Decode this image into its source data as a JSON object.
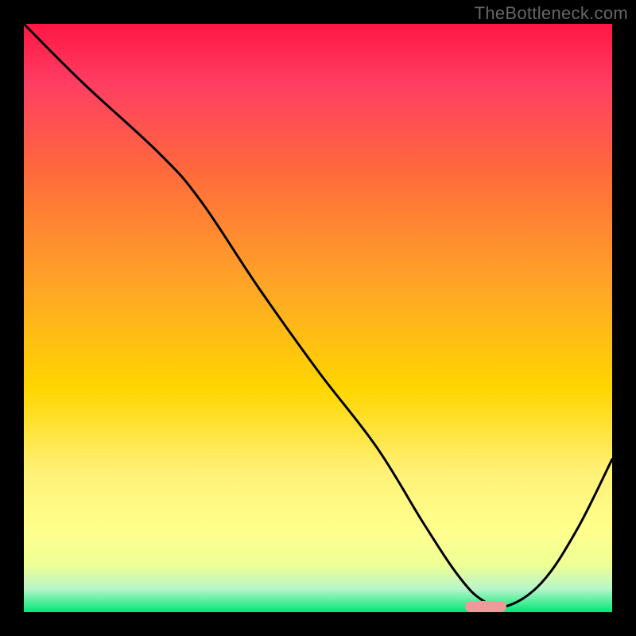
{
  "watermark": "TheBottleneck.com",
  "chart_data": {
    "type": "line",
    "title": "",
    "xlabel": "",
    "ylabel": "",
    "xlim": [
      0,
      100
    ],
    "ylim": [
      0,
      100
    ],
    "series": [
      {
        "name": "bottleneck-curve",
        "x": [
          0,
          10,
          23,
          30,
          40,
          50,
          60,
          68,
          74,
          78,
          82,
          88,
          94,
          100
        ],
        "values": [
          100,
          90,
          78,
          70,
          55,
          41,
          28,
          15,
          6,
          2,
          1,
          5,
          14,
          26
        ]
      }
    ],
    "annotations": [
      {
        "name": "optimal-marker",
        "x_start": 75,
        "x_end": 82,
        "y": 1
      }
    ],
    "gradient_colors": {
      "top": "#ff1744",
      "mid_upper": "#ffa726",
      "mid": "#ffd600",
      "mid_lower": "#ffff8d",
      "bottom": "#00e676"
    }
  }
}
